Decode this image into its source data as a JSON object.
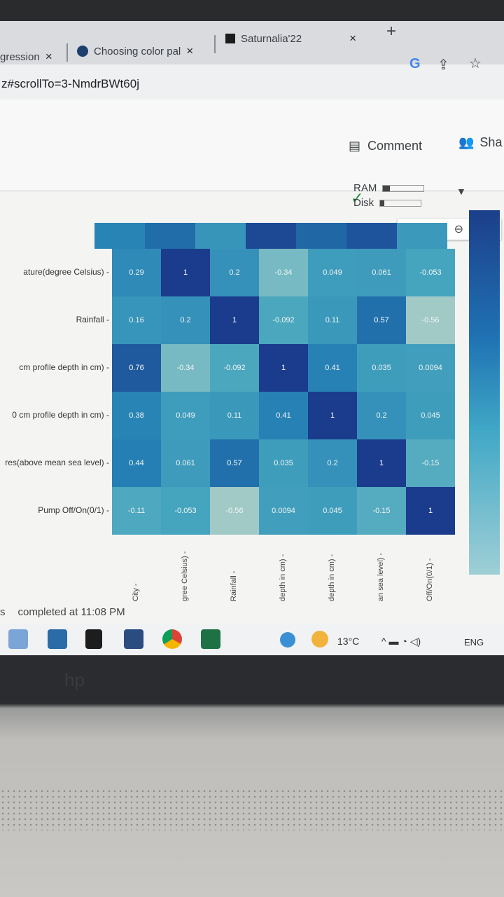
{
  "tabs": [
    {
      "label": "gression",
      "close": "×"
    },
    {
      "label": "Choosing color pal",
      "close": "×"
    },
    {
      "label": "Saturnalia'22",
      "close": "×"
    }
  ],
  "new_tab": "+",
  "url": "z#scrollTo=3-NmdrBWt60j",
  "toolbar": {
    "comment_label": "Comment",
    "share_label": "Sha"
  },
  "resources": {
    "ram_label": "RAM",
    "disk_label": "Disk"
  },
  "heatmap": {
    "rows": [
      "ature(degree Celsius) -",
      "Rainfall -",
      "cm profile depth in cm) -",
      "0 cm profile depth in cm) -",
      "res(above mean sea level) -",
      "Pump Off/On(0/1) -"
    ],
    "columns": [
      "City -",
      "gree Celsius) -",
      "Rainfall -",
      "depth in cm) -",
      "depth in cm) -",
      "an sea level) -",
      "Off/On(0/1) -"
    ],
    "values": [
      [
        "0.29",
        "1",
        "0.2",
        "-0.34",
        "0.049",
        "0.061",
        "-0.053"
      ],
      [
        "0.16",
        "0.2",
        "1",
        "-0.092",
        "0.11",
        "0.57",
        "-0.56"
      ],
      [
        "0.76",
        "-0.34",
        "-0.092",
        "1",
        "0.41",
        "0.035",
        "0.0094"
      ],
      [
        "0.38",
        "0.049",
        "0.11",
        "0.41",
        "1",
        "0.2",
        "0.045"
      ],
      [
        "0.44",
        "0.061",
        "0.57",
        "0.035",
        "0.2",
        "1",
        "-0.15"
      ],
      [
        "-0.11",
        "-0.053",
        "-0.56",
        "0.0094",
        "0.045",
        "-0.15",
        "1"
      ]
    ]
  },
  "status": {
    "text": "completed at 11:08 PM"
  },
  "taskbar": {
    "temperature": "13°C",
    "language": "ENG"
  }
}
